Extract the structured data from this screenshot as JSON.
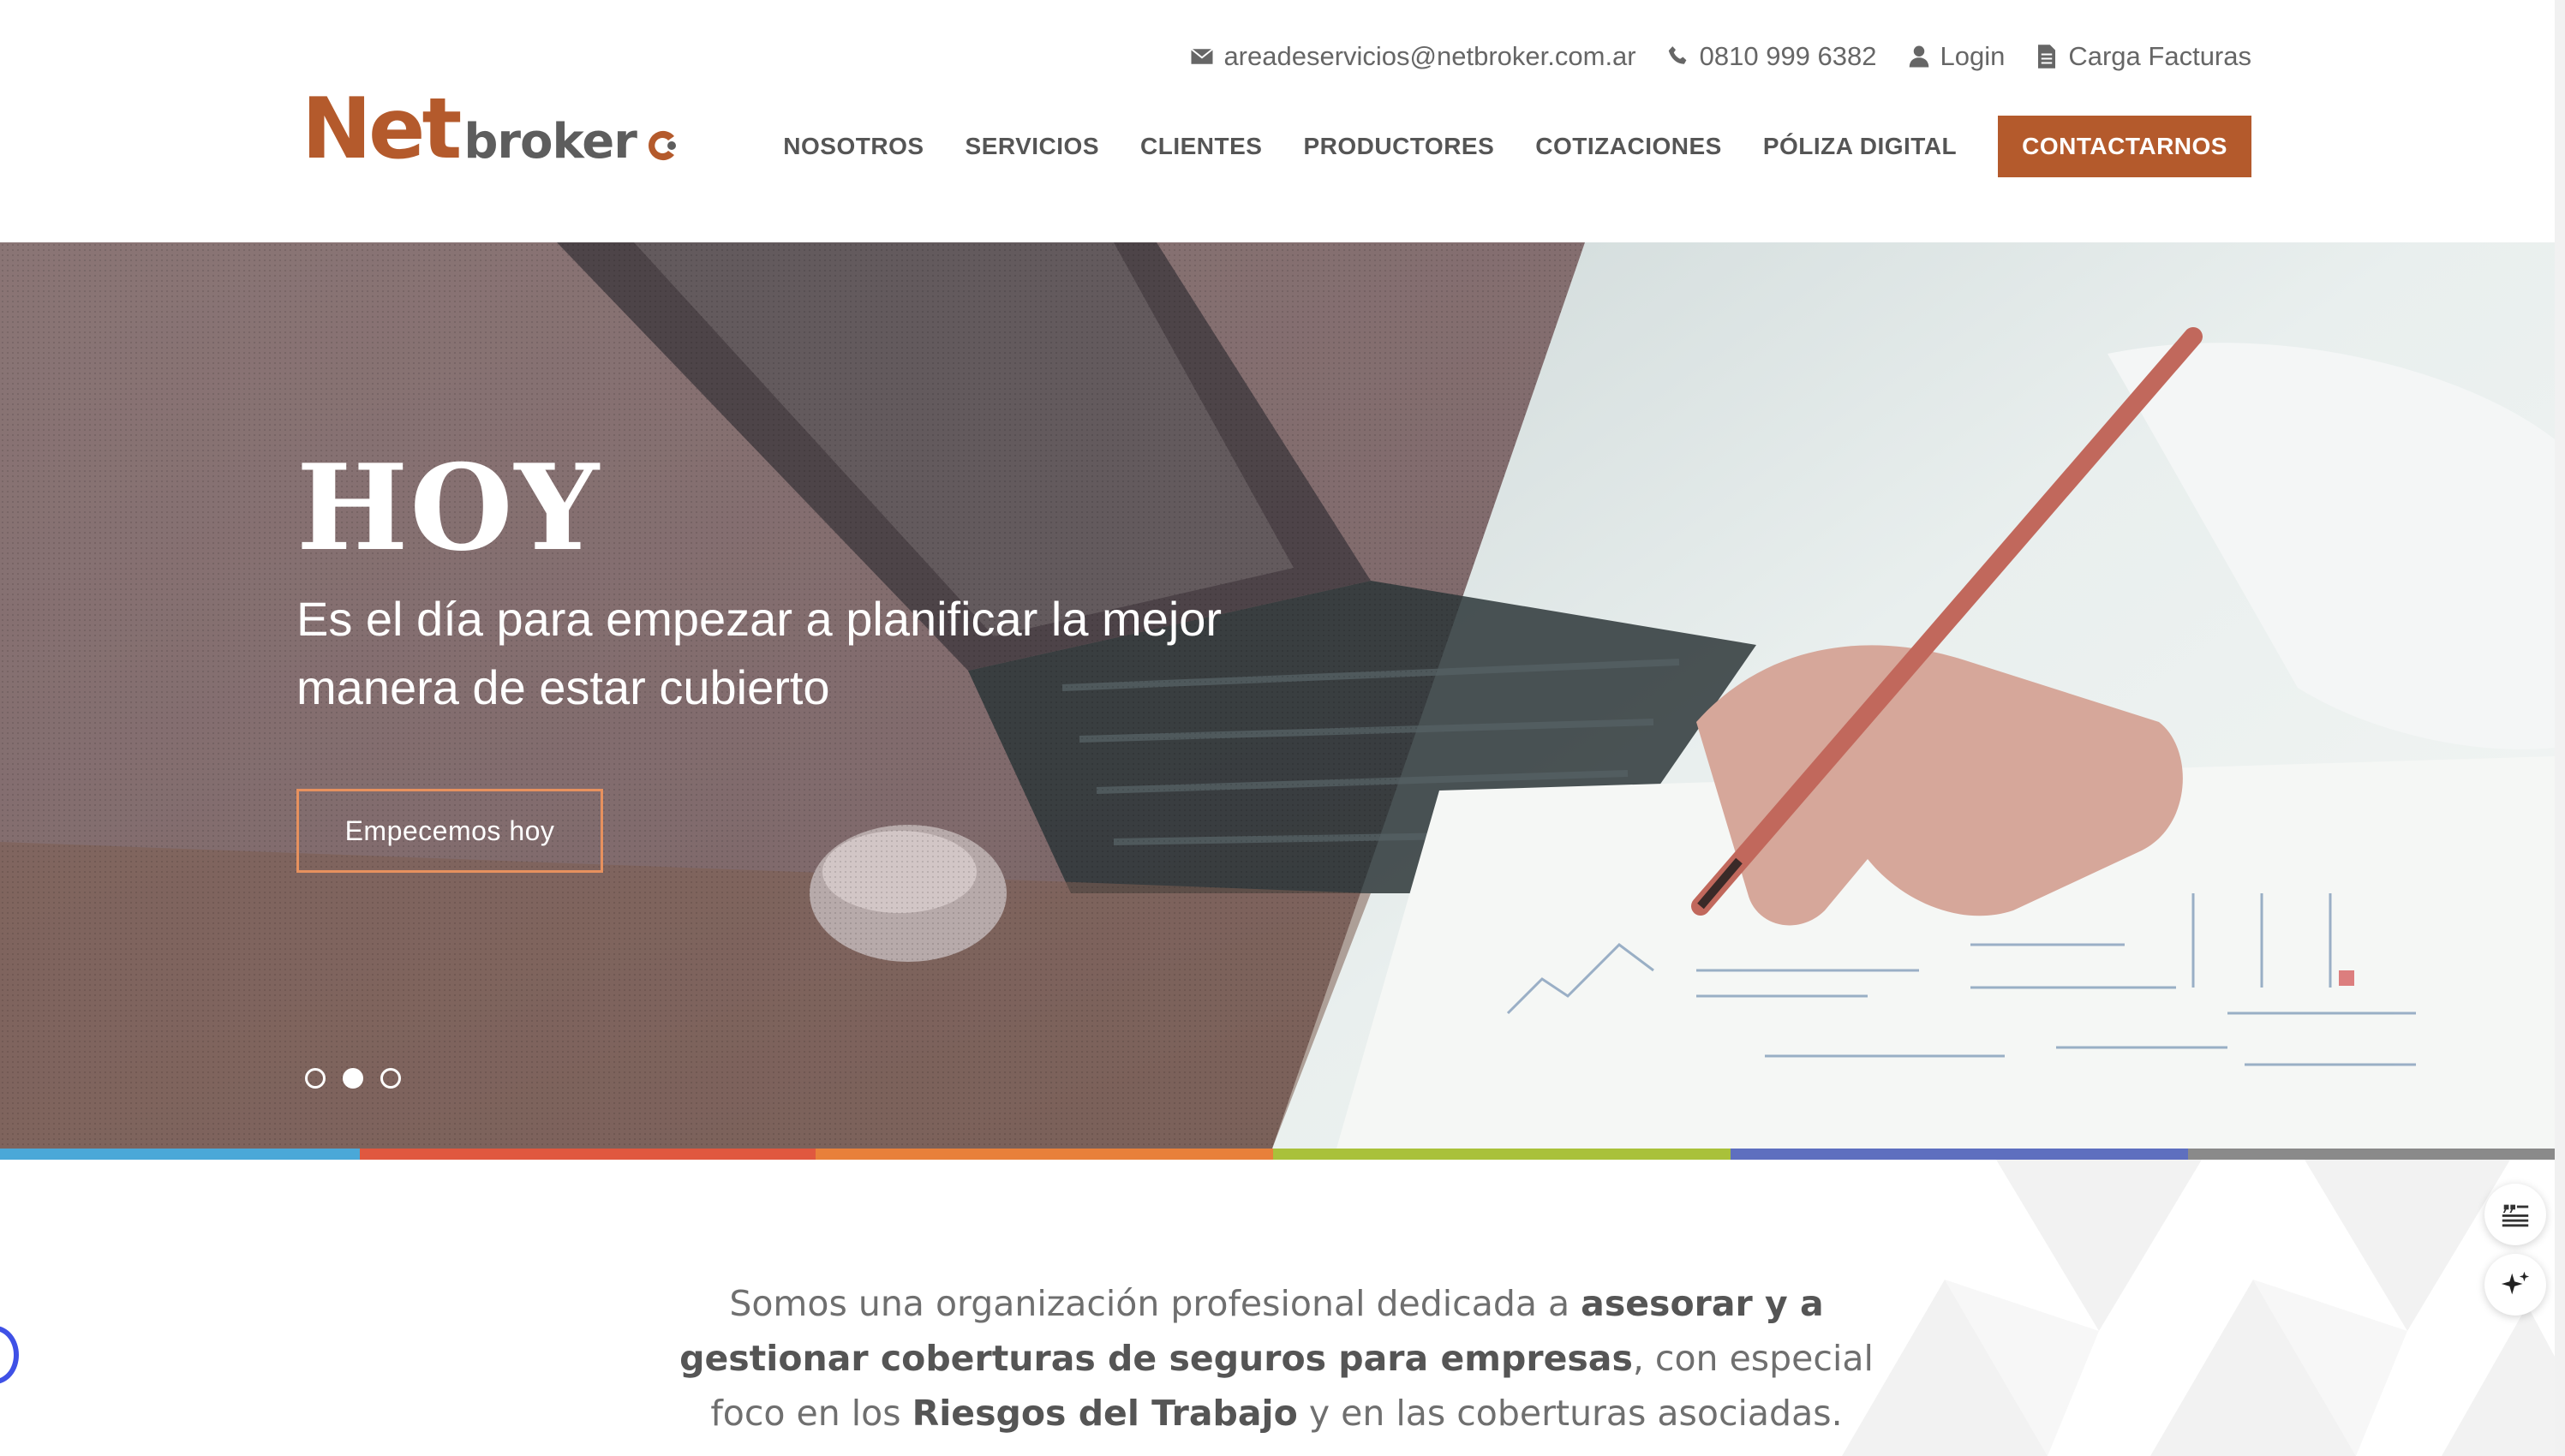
{
  "topbar": {
    "email": "areadeservicios@netbroker.com.ar",
    "phone": "0810 999 6382",
    "login": "Login",
    "invoices": "Carga Facturas"
  },
  "logo": {
    "net": "Net",
    "broker": "broker"
  },
  "nav": {
    "items": [
      "NOSOTROS",
      "SERVICIOS",
      "CLIENTES",
      "PRODUCTORES",
      "COTIZACIONES",
      "PÓLIZA DIGITAL"
    ],
    "cta": "CONTACTARNOS"
  },
  "hero": {
    "title": "HOY",
    "subtitle": "Es el día para empezar a planificar la mejor manera de estar cubierto",
    "button": "Empecemos hoy",
    "slides": 3,
    "active_slide": 2
  },
  "colors": {
    "brand": "#b45a2c",
    "bar": [
      "#4aa8d8",
      "#e0583f",
      "#e8803a",
      "#a9c13a",
      "#5e6fbf",
      "#8a8a8a"
    ]
  },
  "intro": {
    "p1": "Somos una organización profesional dedicada a ",
    "b1": "asesorar y a gestionar coberturas de seguros para empresas",
    "p2": ", con especial foco en los ",
    "b2": "Riesgos del Trabajo",
    "p3": " y en las coberturas asociadas."
  }
}
